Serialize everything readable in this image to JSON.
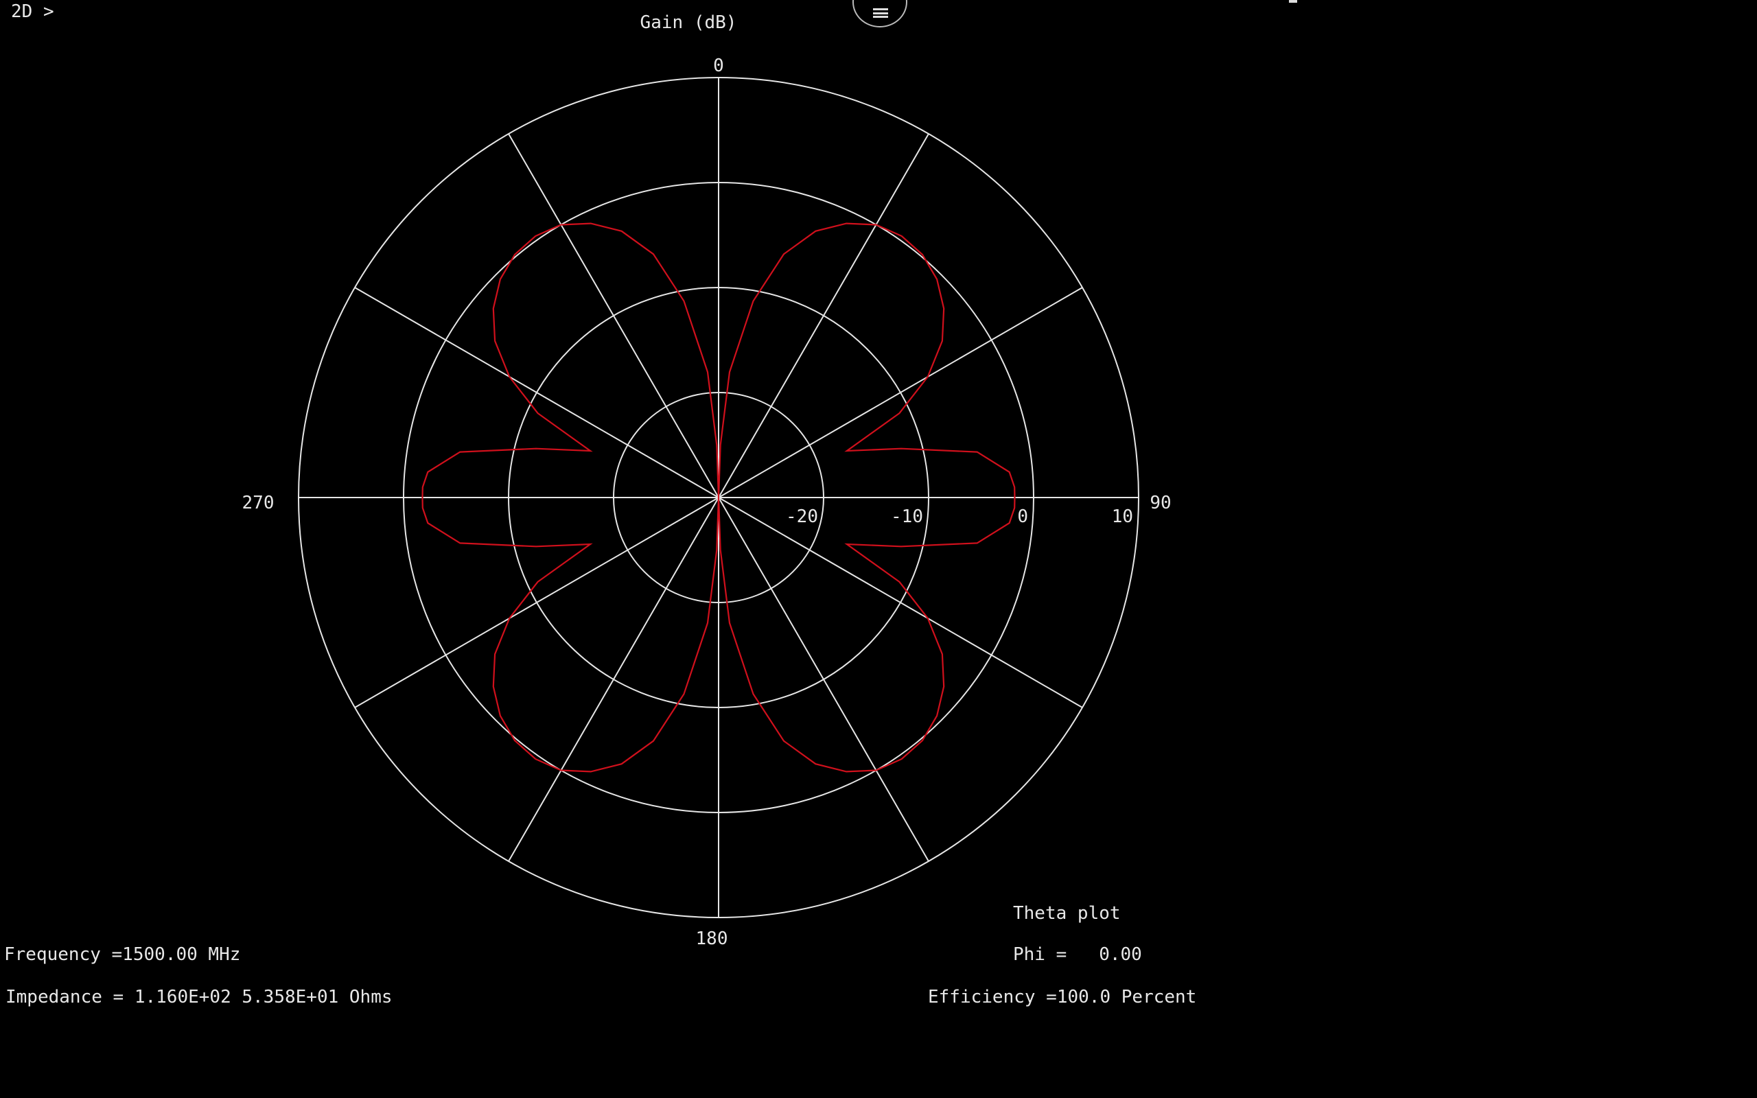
{
  "prompt": "2D >",
  "menu": {
    "icon": "menu-icon"
  },
  "chart_data": {
    "type": "polar-line",
    "title": "Gain (dB)",
    "radial_axis": {
      "ticks": [
        -20,
        -10,
        0,
        10
      ],
      "range_db": [
        -30,
        10
      ]
    },
    "angle_labels": {
      "top": "0",
      "right": "90",
      "bottom": "180",
      "left": "270"
    },
    "spokes_deg": [
      0,
      30,
      60,
      90,
      120,
      150,
      180,
      210,
      240,
      270,
      300,
      330
    ],
    "grid": true,
    "series": [
      {
        "color": "#d0101c",
        "theta_deg": [
          0,
          2,
          5,
          10,
          15,
          20,
          25,
          30,
          35,
          40,
          45,
          50,
          55,
          60,
          65,
          70,
          75,
          80,
          85,
          88,
          90
        ],
        "gain_db": [
          -30,
          -25,
          -18,
          -11,
          -6,
          -3,
          -1.2,
          0,
          0.4,
          0.2,
          -0.6,
          -2,
          -4,
          -7,
          -11,
          -17,
          -12,
          -5,
          -2.2,
          -1.8,
          -1.8
        ]
      }
    ]
  },
  "info": {
    "frequency": "Frequency =1500.00 MHz",
    "impedance": "Impedance = 1.160E+02 5.358E+01 Ohms",
    "plot_type": "Theta plot",
    "phi": "Phi =   0.00",
    "efficiency": "Efficiency =100.0 Percent"
  }
}
